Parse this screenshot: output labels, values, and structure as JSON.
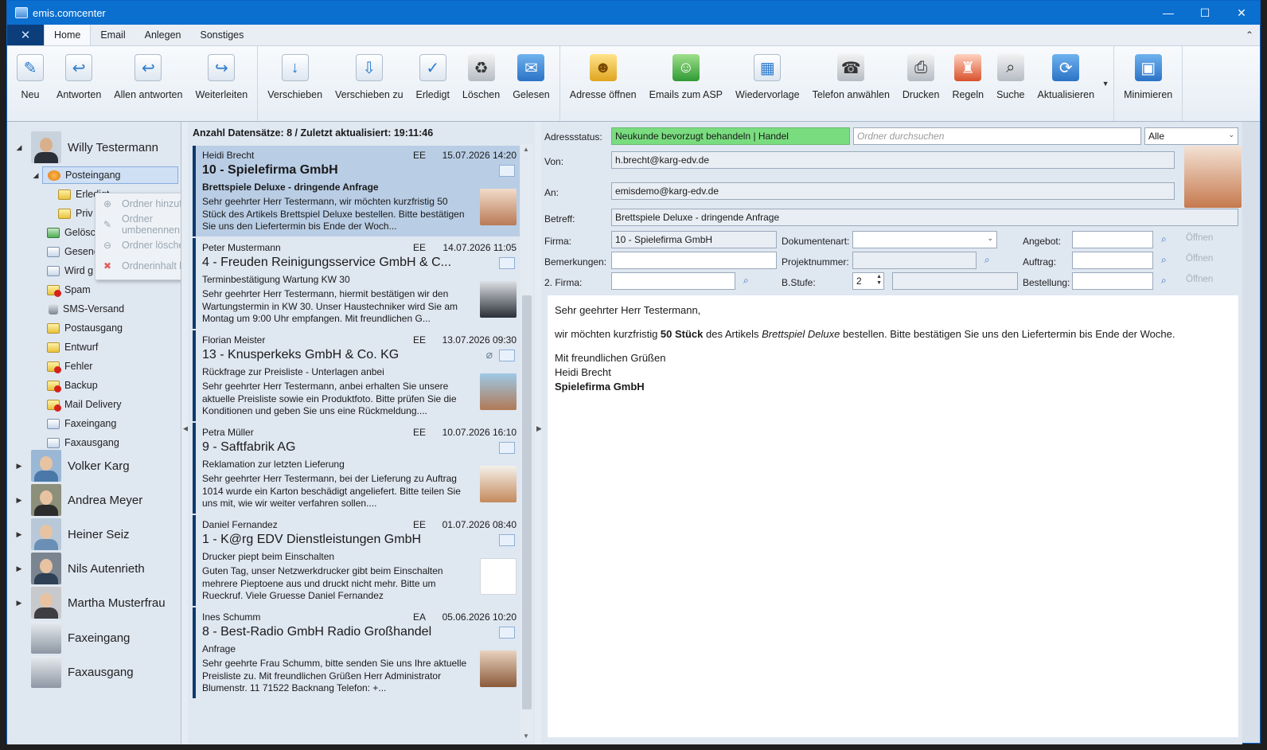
{
  "window": {
    "title": "emis.comcenter"
  },
  "menu": {
    "tabs": [
      "Home",
      "Email",
      "Anlegen",
      "Sonstiges"
    ]
  },
  "ribbon": {
    "group1": [
      "Neu",
      "Antworten",
      "Allen antworten",
      "Weiterleiten"
    ],
    "group2": [
      "Verschieben",
      "Verschieben zu",
      "Erledigt",
      "Löschen",
      "Gelesen"
    ],
    "group3": [
      "Adresse öffnen",
      "Emails zum ASP",
      "Wiedervorlage",
      "Telefon anwählen",
      "Drucken",
      "Regeln",
      "Suche",
      "Aktualisieren"
    ],
    "group4": [
      "Minimieren"
    ]
  },
  "nav": {
    "users": [
      {
        "name": "Willy Testermann"
      },
      {
        "name": "Volker Karg"
      },
      {
        "name": "Andrea Meyer"
      },
      {
        "name": "Heiner Seiz"
      },
      {
        "name": "Nils Autenrieth"
      },
      {
        "name": "Martha Musterfrau"
      },
      {
        "name": "Faxeingang"
      },
      {
        "name": "Faxausgang"
      }
    ],
    "folders": [
      "Posteingang",
      "Erledigt",
      "Priv",
      "Gelöscht",
      "Gesendet",
      "Wird g",
      "Spam",
      "SMS-Versand",
      "Postausgang",
      "Entwurf",
      "Fehler",
      "Backup",
      "Mail Delivery",
      "Faxeingang",
      "Faxausgang"
    ],
    "context_menu": [
      "Ordner hinzufügen",
      "Ordner umbenennen",
      "Ordner löschen",
      "Ordnerinhalt leeren"
    ]
  },
  "list": {
    "header": "Anzahl Datensätze: 8 / Zuletzt aktualisiert: 19:11:46",
    "messages": [
      {
        "sender": "Heidi Brecht",
        "kind": "EE",
        "date": "15.07.2026 14:20",
        "company": "10 - Spielefirma GmbH",
        "subject": "Brettspiele Deluxe - dringende Anfrage",
        "preview": "Sehr geehrter Herr Testermann,  wir möchten kurzfristig 50 Stück des Artikels Brettspiel Deluxe bestellen. Bitte bestätigen Sie uns den Liefertermin bis Ende der Woch...",
        "attachment": false
      },
      {
        "sender": "Peter Mustermann",
        "kind": "EE",
        "date": "14.07.2026 11:05",
        "company": "4 - Freuden Reinigungsservice GmbH & C...",
        "subject": "Terminbestätigung Wartung KW 30",
        "preview": "Sehr geehrter Herr Testermann,  hiermit bestätigen wir den Wartungstermin in KW 30. Unser Haustechniker wird Sie am Montag um 9:00 Uhr empfangen.  Mit freundlichen G...",
        "attachment": false
      },
      {
        "sender": "Florian Meister",
        "kind": "EE",
        "date": "13.07.2026 09:30",
        "company": "13 - Knusperkeks GmbH & Co. KG",
        "subject": "Rückfrage zur Preisliste - Unterlagen anbei",
        "preview": "Sehr geehrter Herr Testermann,  anbei erhalten Sie unsere aktuelle Preisliste sowie ein Produktfoto. Bitte prüfen Sie die Konditionen und geben Sie uns eine Rückmeldung....",
        "attachment": true
      },
      {
        "sender": "Petra Müller",
        "kind": "EE",
        "date": "10.07.2026 16:10",
        "company": "9 - Saftfabrik AG",
        "subject": "Reklamation zur letzten Lieferung",
        "preview": "Sehr geehrter Herr Testermann,  bei der Lieferung zu Auftrag 1014 wurde ein Karton beschädigt angeliefert. Bitte teilen Sie uns mit, wie wir weiter verfahren sollen....",
        "attachment": false
      },
      {
        "sender": "Daniel Fernandez",
        "kind": "EE",
        "date": "01.07.2026 08:40",
        "company": "1 - K@rg EDV Dienstleistungen GmbH",
        "subject": "Drucker piept beim Einschalten",
        "preview": "Guten Tag,  unser Netzwerkdrucker gibt beim Einschalten mehrere Pieptoene aus und druckt nicht mehr. Bitte um Rueckruf.  Viele Gruesse Daniel Fernandez",
        "attachment": false
      },
      {
        "sender": "Ines Schumm",
        "kind": "EA",
        "date": "05.06.2026 10:20",
        "company": "8 - Best-Radio GmbH Radio Großhandel",
        "subject": "Anfrage",
        "preview": "Sehr geehrte Frau Schumm,  bitte senden Sie uns Ihre aktuelle Preisliste zu.  Mit freundlichen Grüßen    Herr Administrator  Blumenstr. 11  71522 Backnang  Telefon: +...",
        "attachment": false
      }
    ]
  },
  "detail": {
    "labels": {
      "adressstatus": "Adressstatus:",
      "von": "Von:",
      "an": "An:",
      "betreff": "Betreff:",
      "firma": "Firma:",
      "dokumentenart": "Dokumentenart:",
      "angebot": "Angebot:",
      "bemerkungen": "Bemerkungen:",
      "projektnummer": "Projektnummer:",
      "auftrag": "Auftrag:",
      "firma2": "2. Firma:",
      "bstufe": "B.Stufe:",
      "bestellung": "Bestellung:",
      "offnen": "Öffnen"
    },
    "adressstatus": "Neukunde bevorzugt behandeln | Handel",
    "search_placeholder": "Ordner durchsuchen",
    "filter": "Alle",
    "von": "h.brecht@karg-edv.de",
    "an": "emisdemo@karg-edv.de",
    "betreff": "Brettspiele Deluxe - dringende Anfrage",
    "firma": "10 - Spielefirma GmbH",
    "dokumentenart": "",
    "bstufe": "2",
    "body": {
      "greeting": "Sehr geehrter Herr Testermann,",
      "line_pre": "wir möchten kurzfristig ",
      "line_bold": "50 Stück",
      "line_mid": " des Artikels ",
      "line_italic": "Brettspiel Deluxe",
      "line_post": " bestellen. Bitte bestätigen Sie uns den Liefertermin bis Ende der Woche.",
      "closing": "Mit freundlichen Grüßen",
      "name": "Heidi Brecht",
      "company": "Spielefirma GmbH"
    }
  },
  "colors": {
    "accent": "#0b6fd0",
    "status_green": "#79dd7f",
    "selected_row": "#b9cde5"
  }
}
